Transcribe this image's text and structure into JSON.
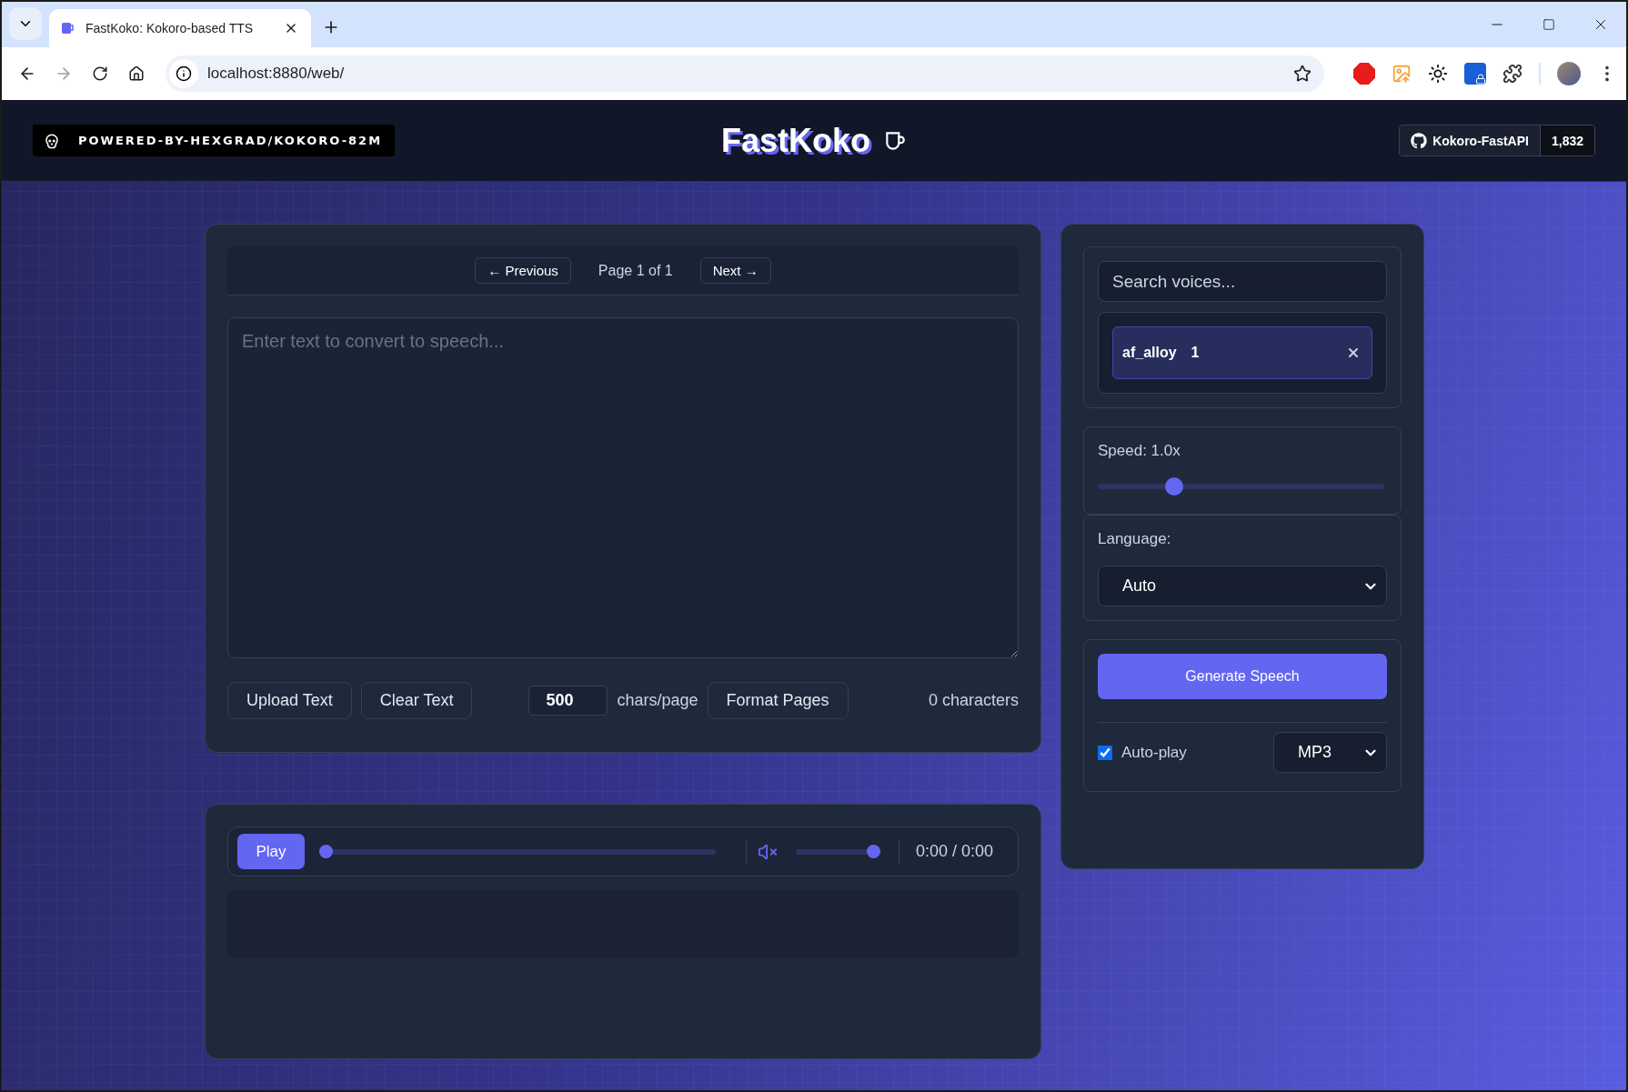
{
  "browser": {
    "tab_title": "FastKoko: Kokoro-based TTS",
    "url": "localhost:8880/web/"
  },
  "header": {
    "badge": "POWERED-BY-HEXGRAD/KOKORO-82M",
    "title": "FastKoko",
    "repo": {
      "label": "Kokoro-FastAPI",
      "count": "1,832"
    }
  },
  "editor": {
    "pagination": {
      "previous": "← Previous",
      "page": "Page 1 of 1",
      "next": "Next →"
    },
    "placeholder": "Enter text to convert to speech...",
    "upload": "Upload Text",
    "clear": "Clear Text",
    "chars_per_page": "500",
    "chars_per_page_label": "chars/page",
    "format": "Format Pages",
    "count": "0 characters"
  },
  "player": {
    "play": "Play",
    "progress": {
      "level": 0
    },
    "muted": true,
    "volume": {
      "level": 1
    },
    "time": "0:00 / 0:00"
  },
  "voices": {
    "placeholder": "Search voices...",
    "selected": [
      {
        "name": "af_alloy",
        "weight": "1"
      }
    ]
  },
  "speed": {
    "label": "Speed: 1.0x",
    "level": 0.25
  },
  "language": {
    "label": "Language:",
    "value": "Auto"
  },
  "generate": {
    "button": "Generate Speech",
    "autoplay": {
      "label": "Auto-play",
      "checked": true
    },
    "format": "MP3"
  }
}
